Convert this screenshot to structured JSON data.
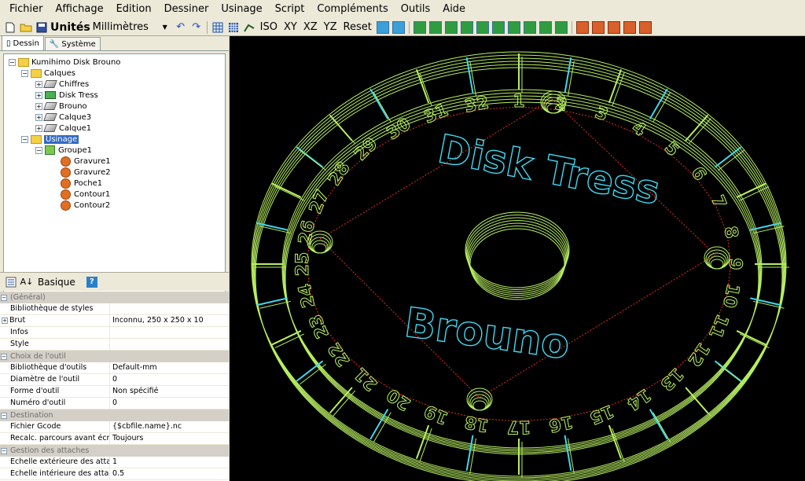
{
  "menu": [
    "Fichier",
    "Affichage",
    "Edition",
    "Dessiner",
    "Usinage",
    "Script",
    "Compléments",
    "Outils",
    "Aide"
  ],
  "toolbar": {
    "units_label": "Unités",
    "units_value": "Millimètres",
    "views": [
      "ISO",
      "XY",
      "XZ",
      "YZ",
      "Reset"
    ]
  },
  "tabs": {
    "dessin": "Dessin",
    "systeme": "Système"
  },
  "tree": {
    "root": "Kumihimo Disk Brouno",
    "calques": "Calques",
    "layers": [
      "Chiffres",
      "Disk Tress",
      "Brouno",
      "Calque3",
      "Calque1"
    ],
    "usinage": "Usinage",
    "groupe": "Groupe1",
    "ops": [
      "Gravure1",
      "Gravure2",
      "Poche1",
      "Contour1",
      "Contour2"
    ]
  },
  "propbar": {
    "basic": "Basique"
  },
  "props": {
    "general": "(Général)",
    "general_rows": [
      [
        "Bibliothèque de styles",
        ""
      ],
      [
        "Brut",
        "Inconnu, 250 x 250 x 10"
      ],
      [
        "Infos",
        ""
      ],
      [
        "Style",
        ""
      ]
    ],
    "tool": "Choix de l'outil",
    "tool_rows": [
      [
        "Bibliothèque d'outils",
        "Default-mm"
      ],
      [
        "Diamètre de l'outil",
        "0"
      ],
      [
        "Forme d'outil",
        "Non spécifié"
      ],
      [
        "Numéro d'outil",
        "0"
      ]
    ],
    "dest": "Destination",
    "dest_rows": [
      [
        "Fichier Gcode",
        "{$cbfile.name}.nc"
      ],
      [
        "Recalc. parcours avant écriture",
        "Toujours"
      ]
    ],
    "attach": "Gestion des attaches",
    "attach_rows": [
      [
        "Echelle extérieure des attaches",
        "1"
      ],
      [
        "Echelle intérieure des attaches",
        "0.5"
      ]
    ]
  },
  "viewport": {
    "text1": "Disk Tress",
    "text2": "Brouno",
    "digits": [
      "1",
      "2",
      "3",
      "4",
      "5",
      "6",
      "7",
      "8",
      "9",
      "10",
      "11",
      "12",
      "13",
      "14",
      "15",
      "16",
      "17",
      "18",
      "19",
      "20",
      "21",
      "22",
      "23",
      "24",
      "25",
      "26",
      "27",
      "28",
      "29",
      "30",
      "31",
      "32"
    ],
    "colors": {
      "background": "#000000",
      "ring": "#b8f060",
      "text": "#40d8f0",
      "rapid": "#e03020"
    }
  }
}
